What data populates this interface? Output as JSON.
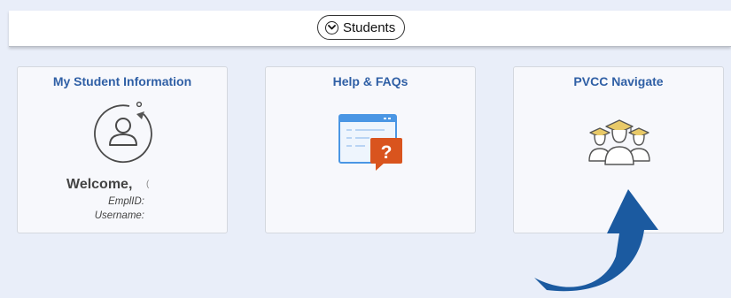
{
  "header": {
    "students_label": "Students",
    "chevron_icon": "chevron-down-icon"
  },
  "tiles": [
    {
      "title": "My Student Information",
      "icon": "user-profile-icon",
      "welcome": "Welcome,",
      "welcome_mark": "(",
      "emplid_label": "EmplID:",
      "username_label": "Username:"
    },
    {
      "title": "Help & FAQs",
      "icon": "help-document-icon",
      "badge": "?"
    },
    {
      "title": "PVCC Navigate",
      "icon": "graduates-icon"
    }
  ],
  "annotation": {
    "icon": "arrow-pointer-icon",
    "color": "#1b5aa0"
  },
  "colors": {
    "background": "#e9eef9",
    "tile_title": "#2f5fa5",
    "help_badge": "#d9541e",
    "grad_cap": "#e8c968"
  }
}
